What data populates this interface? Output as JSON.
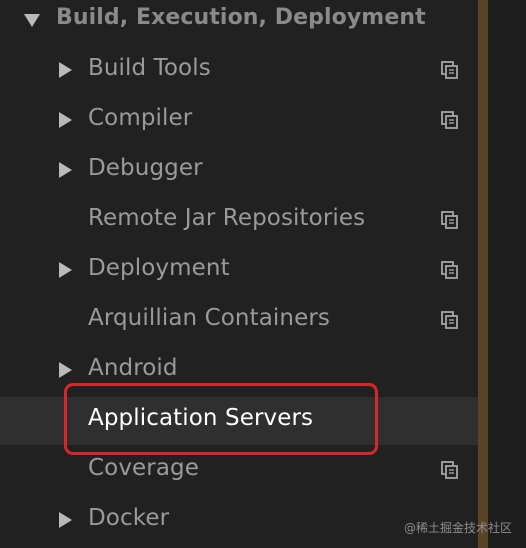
{
  "settings_tree": {
    "header": "Build, Execution, Deployment",
    "items": [
      {
        "label": "Build Tools",
        "expandable": true,
        "copy_icon": true,
        "selected": false
      },
      {
        "label": "Compiler",
        "expandable": true,
        "copy_icon": true,
        "selected": false
      },
      {
        "label": "Debugger",
        "expandable": true,
        "copy_icon": false,
        "selected": false
      },
      {
        "label": "Remote Jar Repositories",
        "expandable": false,
        "copy_icon": true,
        "selected": false
      },
      {
        "label": "Deployment",
        "expandable": true,
        "copy_icon": true,
        "selected": false
      },
      {
        "label": "Arquillian Containers",
        "expandable": false,
        "copy_icon": true,
        "selected": false
      },
      {
        "label": "Android",
        "expandable": true,
        "copy_icon": false,
        "selected": false
      },
      {
        "label": "Application Servers",
        "expandable": false,
        "copy_icon": false,
        "selected": true
      },
      {
        "label": "Coverage",
        "expandable": false,
        "copy_icon": true,
        "selected": false
      },
      {
        "label": "Docker",
        "expandable": true,
        "copy_icon": false,
        "selected": false
      }
    ]
  },
  "icons": {
    "expand": "triangle-right",
    "collapse": "triangle-down",
    "project_settings": "copy-icon"
  },
  "colors": {
    "background": "#212121",
    "text": "#9a9a9a",
    "selected_text": "#ffffff",
    "highlight_border": "#d8262a",
    "scrollbar": "#5a4427"
  },
  "watermark": "@稀土掘金技术社区"
}
